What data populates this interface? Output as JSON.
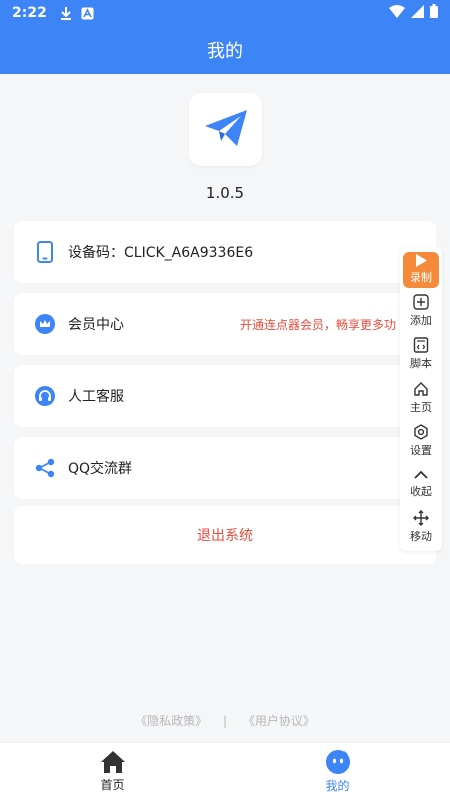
{
  "status_bar": {
    "time": "2:22",
    "icons": [
      "download-icon",
      "notification-a-icon",
      "wifi-icon",
      "signal-icon",
      "battery-icon"
    ]
  },
  "header": {
    "title": "我的"
  },
  "app": {
    "version": "1.0.5",
    "logo": "paper-plane-icon"
  },
  "menu": [
    {
      "icon": "phone-icon",
      "label": "设备码：CLICK_A6A9336E6",
      "extra": ""
    },
    {
      "icon": "crown-icon",
      "label": "会员中心",
      "extra": "开通连点器会员，畅享更多功"
    },
    {
      "icon": "headset-icon",
      "label": "人工客服",
      "extra": ""
    },
    {
      "icon": "share-icon",
      "label": "QQ交流群",
      "extra": ""
    }
  ],
  "logout": {
    "label": "退出系统"
  },
  "footer": {
    "privacy": "《隐私政策》",
    "separator": "|",
    "agreement": "《用户协议》"
  },
  "floating_toolbar": [
    {
      "icon": "play-icon",
      "label": "录制"
    },
    {
      "icon": "plus-square-icon",
      "label": "添加"
    },
    {
      "icon": "script-icon",
      "label": "脚本"
    },
    {
      "icon": "home-icon",
      "label": "主页"
    },
    {
      "icon": "settings-icon",
      "label": "设置"
    },
    {
      "icon": "chevron-up-icon",
      "label": "收起"
    },
    {
      "icon": "move-icon",
      "label": "移动"
    }
  ],
  "bottom_nav": [
    {
      "icon": "home-icon",
      "label": "首页",
      "active": false
    },
    {
      "icon": "mascot-icon",
      "label": "我的",
      "active": true
    }
  ],
  "colors": {
    "primary": "#3d84f6",
    "accent_orange": "#f58a3a",
    "danger": "#e84c3d",
    "background": "#f5f6f8"
  }
}
